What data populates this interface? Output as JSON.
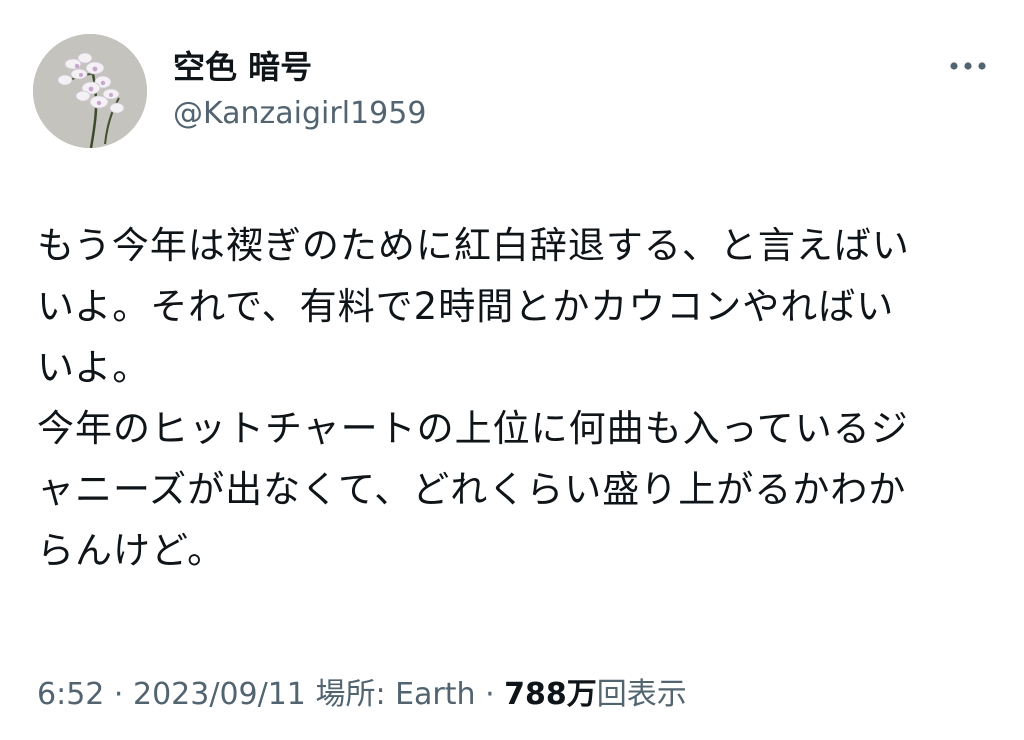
{
  "user": {
    "display_name": "空色 暗号",
    "handle": "@Kanzaigirl1959",
    "avatar_icon": "orchid-flower-avatar"
  },
  "more_icon": "more-horizontal-icon",
  "tweet": {
    "text": "もう今年は禊ぎのために紅白辞退する、と言えばい\nいよ。それで、有料で2時間とかカウコンやればい\nいよ。\n今年のヒットチャートの上位に何曲も入っているジ\nャニーズが出なくて、どれくらい盛り上がるかわか\nらんけど。"
  },
  "meta": {
    "time": "6:52",
    "sep1": " · ",
    "date": "2023/09/11",
    "location_label": " 場所: Earth",
    "sep2": " · ",
    "views_count": "788万",
    "views_label": "回表示"
  },
  "colors": {
    "text_primary": "#0f1419",
    "text_secondary": "#536471",
    "background": "#ffffff"
  }
}
